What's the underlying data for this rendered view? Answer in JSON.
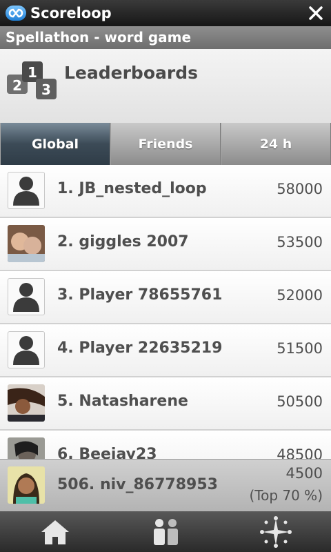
{
  "app": {
    "brand": "Scoreloop",
    "game_title": "Spellathon - word game"
  },
  "header": {
    "title": "Leaderboards",
    "icon_digits": [
      "1",
      "2",
      "3"
    ]
  },
  "tabs": [
    {
      "label": "Global",
      "active": true
    },
    {
      "label": "Friends",
      "active": false
    },
    {
      "label": "24 h",
      "active": false
    }
  ],
  "leaderboard": [
    {
      "rank_name": "1. JB_nested_loop",
      "score": "58000",
      "avatar": "default-person-icon"
    },
    {
      "rank_name": "2. giggles 2007",
      "score": "53500",
      "avatar": "photo"
    },
    {
      "rank_name": "3. Player 78655761",
      "score": "52000",
      "avatar": "default-person-icon"
    },
    {
      "rank_name": "4. Player 22635219",
      "score": "51500",
      "avatar": "default-person-icon"
    },
    {
      "rank_name": "5. Natasharene",
      "score": "50500",
      "avatar": "photo"
    },
    {
      "rank_name": "6. Beejay23",
      "score": "48500",
      "avatar": "photo"
    }
  ],
  "current_user": {
    "rank_name": "506. niv_86778953",
    "score": "4500",
    "percentile": "(Top 70 %)",
    "avatar": "photo"
  },
  "bottom_nav": [
    {
      "icon": "home-icon"
    },
    {
      "icon": "people-icon"
    },
    {
      "icon": "sparkle-icon"
    }
  ],
  "colors": {
    "active_tab": "#3c4b57",
    "brand_blue": "#1f7fd6"
  }
}
